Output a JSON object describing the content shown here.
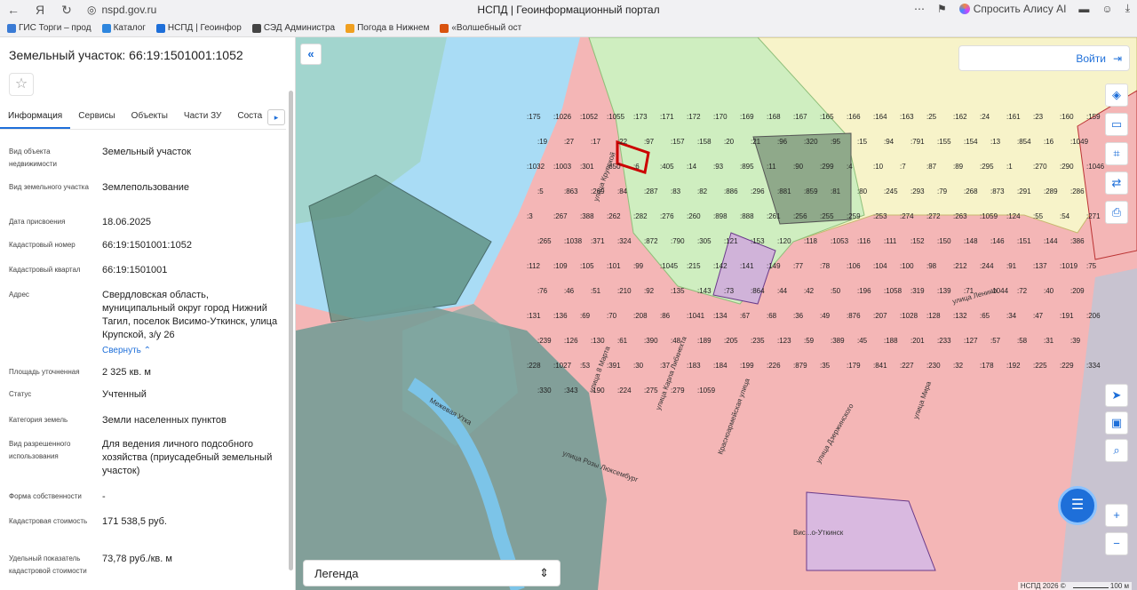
{
  "browser": {
    "url": "nspd.gov.ru",
    "title": "НСПД | Геоинформационный портал",
    "alice_label": "Спросить Алису AI"
  },
  "bookmarks": [
    {
      "label": "ГИС Торги – прод",
      "color": "#3a7bd5"
    },
    {
      "label": "Каталог",
      "color": "#2e86de"
    },
    {
      "label": "НСПД | Геоинфор",
      "color": "#1e6fd9"
    },
    {
      "label": "СЭД Администра",
      "color": "#444444"
    },
    {
      "label": "Погода в Нижнем",
      "color": "#f0a020"
    },
    {
      "label": "«Волшебный ост",
      "color": "#d9530f"
    }
  ],
  "panel": {
    "title": "Земельный участок: 66:19:1501001:1052",
    "tabs": [
      "Информация",
      "Сервисы",
      "Объекты",
      "Части ЗУ",
      "Соста"
    ],
    "collapse_link": "Свернуть",
    "properties": [
      {
        "label": "Вид объекта недвижимости",
        "value": "Земельный участок"
      },
      {
        "label": "Вид земельного участка",
        "value": "Землепользование"
      },
      {
        "label": "Дата присвоения",
        "value": "18.06.2025"
      },
      {
        "label": "Кадастровый номер",
        "value": "66:19:1501001:1052"
      },
      {
        "label": "Кадастровый квартал",
        "value": "66:19:1501001"
      },
      {
        "label": "Адрес",
        "value": "Свердловская область, муниципальный округ город Нижний Тагил, поселок Висимо-Уткинск, улица Крупской, з/у 26"
      },
      {
        "label": "Площадь уточненная",
        "value": "2 325 кв. м"
      },
      {
        "label": "Статус",
        "value": "Учтенный"
      },
      {
        "label": "Категория земель",
        "value": "Земли населенных пунктов"
      },
      {
        "label": "Вид разрешенного использования",
        "value": "Для ведения личного подсобного хозяйства (приусадебный земельный участок)"
      },
      {
        "label": "Форма собственности",
        "value": "-"
      },
      {
        "label": "Кадастровая стоимость",
        "value": "171 538,5 руб."
      },
      {
        "label": "Удельный показатель кадастровой стоимости",
        "value": "73,78 руб./кв. м"
      }
    ]
  },
  "map": {
    "login_label": "Войти",
    "legend_label": "Легенда",
    "attribution": "НСПД 2026 ©",
    "scale_label": "100 м",
    "street_labels": [
      "улица Крупской",
      "улица 8 Марта",
      "улица Карла Либкнехта",
      "Красноармейская улица",
      "улица Дзержинского",
      "улица Мира",
      "улица Ленина",
      "улица Розы Люксембург",
      "Вис...о-Уткинск",
      "Межевая Утка"
    ],
    "parcel_labels": [
      ":175",
      ":1026",
      ":1052",
      ":1055",
      ":173",
      ":171",
      ":172",
      ":170",
      ":169",
      ":168",
      ":167",
      ":165",
      ":166",
      ":164",
      ":163",
      ":25",
      ":162",
      ":24",
      ":161",
      ":23",
      ":160",
      ":159",
      ":19",
      ":27",
      ":17",
      ":22",
      ":97",
      ":157",
      ":158",
      ":20",
      ":21",
      ":96",
      ":320",
      ":95",
      ":15",
      ":94",
      ":791",
      ":155",
      ":154",
      ":13",
      ":854",
      ":16",
      ":1049",
      ":1037",
      ":1032",
      ":1003",
      ":301",
      ":850",
      ":6",
      ":405",
      ":14",
      ":93",
      ":895",
      ":11",
      ":90",
      ":299",
      ":4",
      ":10",
      ":7",
      ":87",
      ":89",
      ":295",
      ":1",
      ":270",
      ":290",
      ":1046",
      ":5",
      ":863",
      ":269",
      ":84",
      ":287",
      ":83",
      ":82",
      ":886",
      ":296",
      ":881",
      ":859",
      ":81",
      ":80",
      ":245",
      ":293",
      ":79",
      ":268",
      ":873",
      ":291",
      ":289",
      ":286",
      ":1029",
      ":3",
      ":267",
      ":388",
      ":262",
      ":282",
      ":276",
      ":260",
      ":898",
      ":888",
      ":261",
      ":256",
      ":255",
      ":259",
      ":253",
      ":274",
      ":272",
      ":263",
      ":1059",
      ":124",
      ":55",
      ":54",
      ":271",
      ":265",
      ":1038",
      ":371",
      ":324",
      ":872",
      ":790",
      ":305",
      ":121",
      ":153",
      ":120",
      ":118",
      ":1053",
      ":116",
      ":111",
      ":152",
      ":150",
      ":148",
      ":146",
      ":151",
      ":144",
      ":386",
      ":114",
      ":112",
      ":109",
      ":105",
      ":101",
      ":99",
      ":1045",
      ":215",
      ":142",
      ":141",
      ":149",
      ":77",
      ":78",
      ":106",
      ":104",
      ":100",
      ":98",
      ":212",
      ":244",
      ":91",
      ":137",
      ":1019",
      ":75",
      ":76",
      ":46",
      ":51",
      ":210",
      ":92",
      ":135",
      ":143",
      ":73",
      ":864",
      ":44",
      ":42",
      ":50",
      ":196",
      ":1058",
      ":319",
      ":139",
      ":71",
      ":1044",
      ":72",
      ":40",
      ":209",
      ":793",
      ":131",
      ":136",
      ":69",
      ":70",
      ":208",
      ":86",
      ":1041",
      ":134",
      ":67",
      ":68",
      ":36",
      ":49",
      ":876",
      ":207",
      ":1028",
      ":128",
      ":132",
      ":65",
      ":34",
      ":47",
      ":191",
      ":206",
      ":239",
      ":126",
      ":130",
      ":61",
      ":390",
      ":48",
      ":189",
      ":205",
      ":235",
      ":123",
      ":59",
      ":389",
      ":45",
      ":188",
      ":201",
      ":233",
      ":127",
      ":57",
      ":58",
      ":31",
      ":39",
      ":1042",
      ":228",
      ":1027",
      ":53",
      ":391",
      ":30",
      ":37",
      ":183",
      ":184",
      ":199",
      ":226",
      ":879",
      ":35",
      ":179",
      ":841",
      ":227",
      ":230",
      ":32",
      ":178",
      ":192",
      ":225",
      ":229",
      ":334",
      ":330",
      ":343",
      ":190",
      ":224",
      ":275",
      ":279",
      ":1059"
    ]
  }
}
